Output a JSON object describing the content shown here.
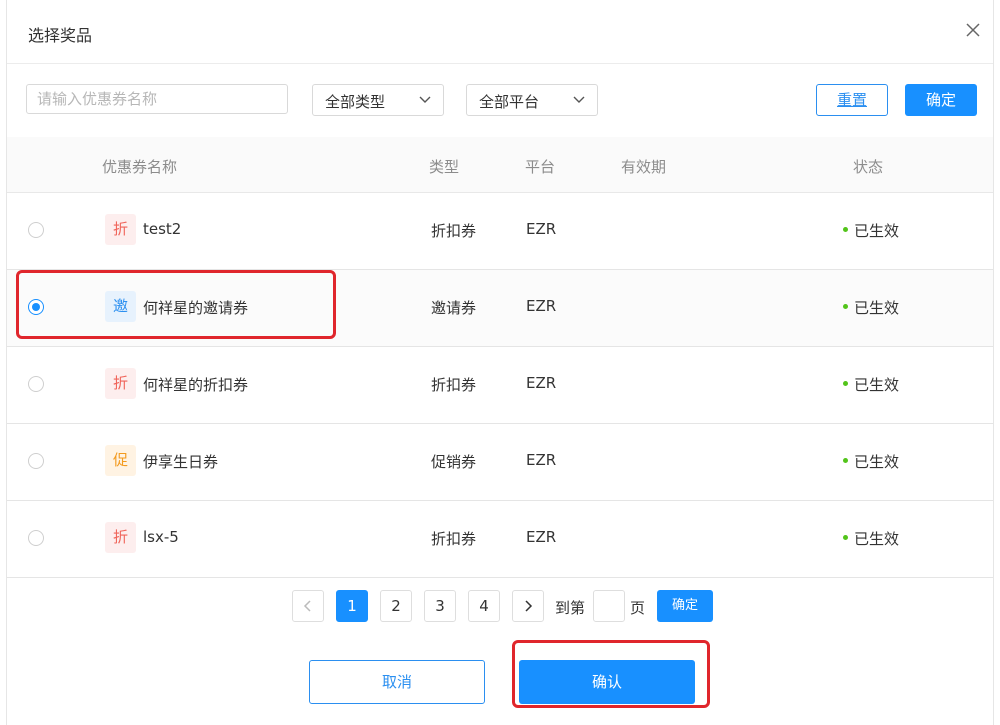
{
  "dialog": {
    "title": "选择奖品"
  },
  "filters": {
    "search_placeholder": "请输入优惠券名称",
    "type_select": "全部类型",
    "platform_select": "全部平台",
    "reset_label": "重置",
    "confirm_label": "确定"
  },
  "table": {
    "headers": {
      "name": "优惠券名称",
      "type": "类型",
      "platform": "平台",
      "validity": "有效期",
      "status": "状态"
    },
    "rows": [
      {
        "badge": "折",
        "name": "test2",
        "type": "折扣券",
        "platform": "EZR",
        "validity": "",
        "status": "已生效",
        "selected": false
      },
      {
        "badge": "邀",
        "name": "何祥星的邀请券",
        "type": "邀请券",
        "platform": "EZR",
        "validity": "",
        "status": "已生效",
        "selected": true
      },
      {
        "badge": "折",
        "name": "何祥星的折扣券",
        "type": "折扣券",
        "platform": "EZR",
        "validity": "",
        "status": "已生效",
        "selected": false
      },
      {
        "badge": "促",
        "name": "伊享生日券",
        "type": "促销券",
        "platform": "EZR",
        "validity": "",
        "status": "已生效",
        "selected": false
      },
      {
        "badge": "折",
        "name": "lsx-5",
        "type": "折扣券",
        "platform": "EZR",
        "validity": "",
        "status": "已生效",
        "selected": false
      }
    ]
  },
  "pagination": {
    "pages": [
      "1",
      "2",
      "3",
      "4"
    ],
    "current": "1",
    "goto_prefix": "到第",
    "goto_suffix": "页",
    "goto_button": "确定"
  },
  "footer": {
    "cancel_label": "取消",
    "ok_label": "确认"
  },
  "colors": {
    "primary": "#1890ff",
    "status_ok": "#52c41a",
    "highlight": "#e0262c"
  }
}
